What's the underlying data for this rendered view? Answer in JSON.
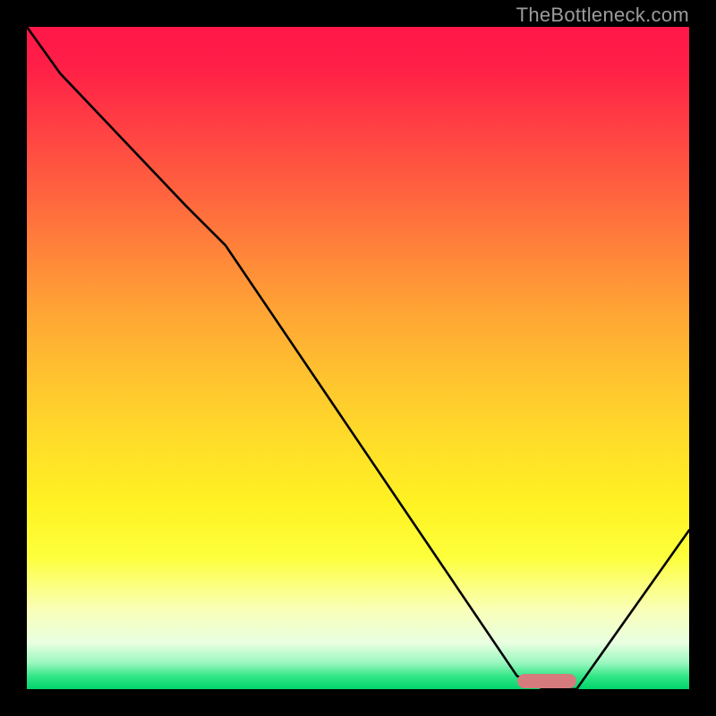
{
  "watermark": "TheBottleneck.com",
  "chart_data": {
    "type": "line",
    "title": "",
    "xlabel": "",
    "ylabel": "",
    "xlim": [
      0,
      100
    ],
    "ylim": [
      0,
      100
    ],
    "grid": false,
    "legend": false,
    "series": [
      {
        "name": "curve",
        "x": [
          0,
          5,
          24,
          30,
          74,
          78,
          83,
          100
        ],
        "y": [
          100,
          93,
          73,
          67,
          2,
          0,
          0,
          24
        ],
        "stroke": "#000000",
        "width": 2.6
      }
    ],
    "optimum_marker": {
      "x_start": 74,
      "x_end": 83,
      "y": 1.2,
      "color": "#d67b7d"
    },
    "background_gradient": [
      "#ff1748",
      "#ff843a",
      "#ffe028",
      "#fdff3b",
      "#00d36a"
    ]
  }
}
